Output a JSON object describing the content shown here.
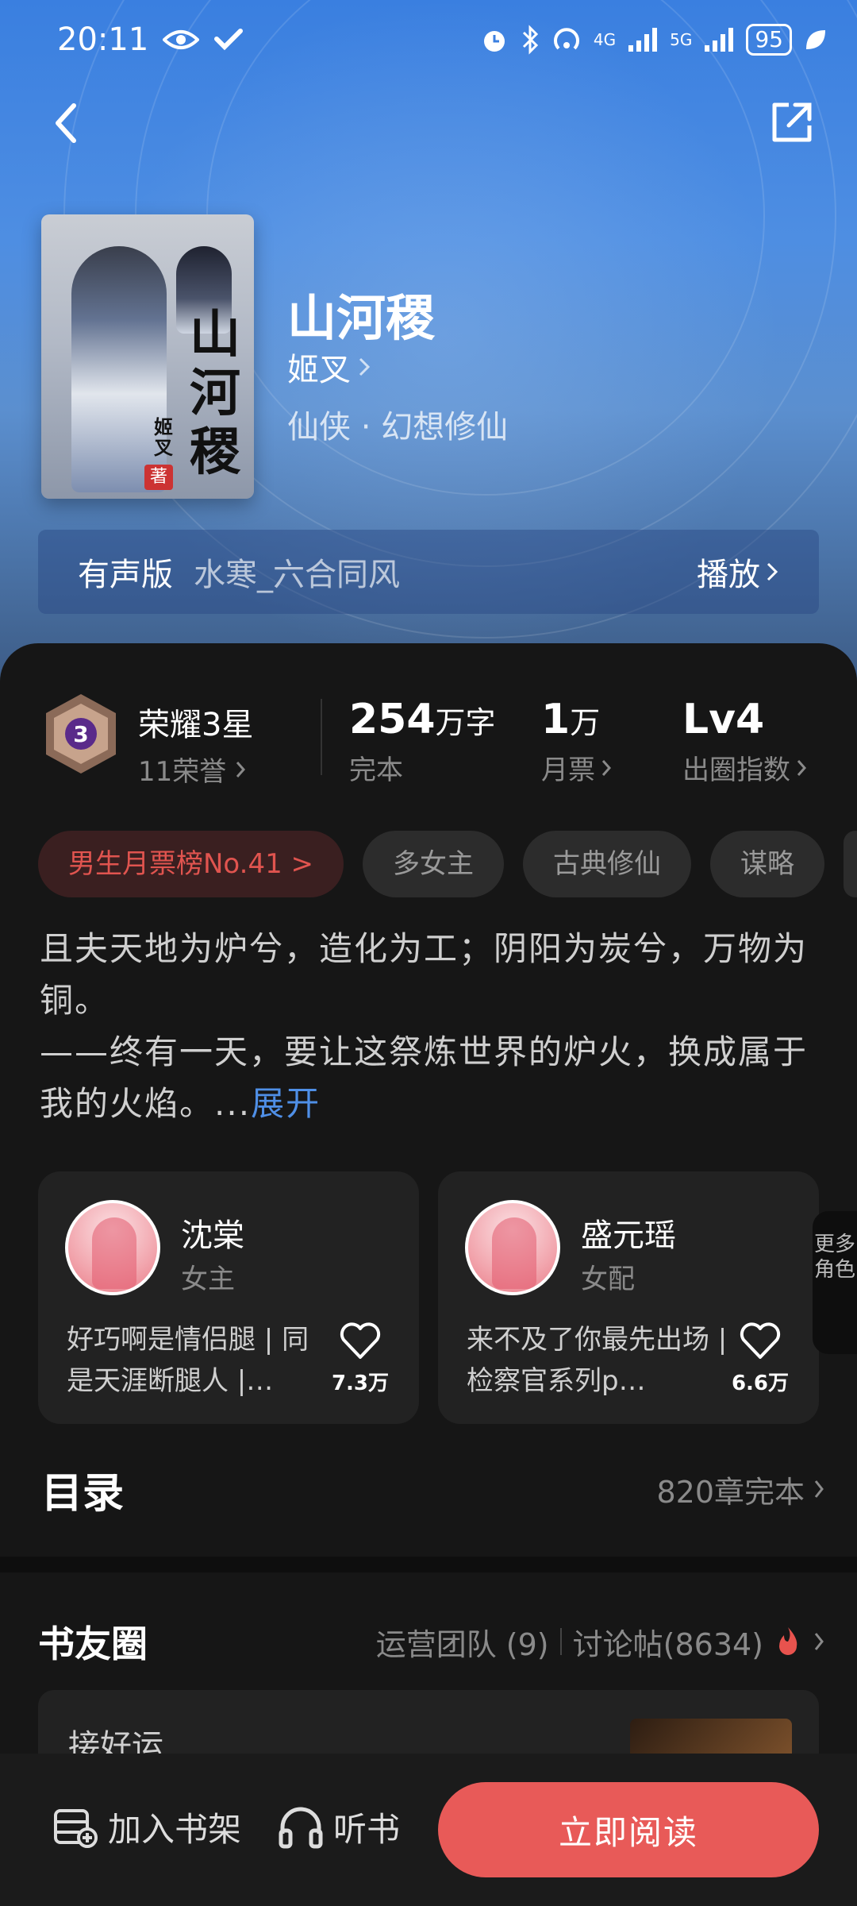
{
  "status_bar": {
    "time": "20:11",
    "signal1": "4G",
    "signal2": "5G",
    "battery": "95"
  },
  "book": {
    "title": "山河稷",
    "author": "姬叉",
    "genre": "仙侠 · 幻想修仙",
    "cover_title": "山河稷",
    "cover_author": "姬叉",
    "cover_seal": "著"
  },
  "audio": {
    "label": "有声版",
    "narrator": "水寒_六合同风",
    "play_label": "播放"
  },
  "stats": {
    "honor_title": "荣耀3星",
    "honor_sub": "11荣誉",
    "badge_level": "3",
    "words_num": "254",
    "words_unit": "万字",
    "words_sub": "完本",
    "votes_num": "1",
    "votes_unit": "万",
    "votes_sub": "月票",
    "index_num": "Lv4",
    "index_sub": "出圈指数"
  },
  "tags": [
    "男生月票榜No.41 >",
    "多女主",
    "古典修仙",
    "谋略"
  ],
  "synopsis": {
    "line1": "且夫天地为炉兮，造化为工；阴阳为炭兮，万物为铜。",
    "line2": "——终有一天，要让这祭炼世界的炉火，换成属于我的火焰。",
    "ellipsis": "...",
    "expand": "展开"
  },
  "characters": [
    {
      "name": "沈棠",
      "role": "女主",
      "desc": "好巧啊是情侣腿 | 同是天涯断腿人 |…",
      "likes": "7.3万"
    },
    {
      "name": "盛元瑶",
      "role": "女配",
      "desc": "来不及了你最先出场 | 检察官系列p…",
      "likes": "6.6万"
    }
  ],
  "more_roles": "更多角色",
  "catalog": {
    "title": "目录",
    "info": "820章完本"
  },
  "circle": {
    "title": "书友圈",
    "team": "运营团队 (9)",
    "posts": "讨论帖(8634)"
  },
  "post": {
    "title": "接好运"
  },
  "bottom": {
    "shelf": "加入书架",
    "listen": "听书",
    "read": "立即阅读"
  },
  "colors": {
    "accent_red": "#e85a58",
    "link_blue": "#4f8fe6",
    "hero_blue": "#3a7fe0"
  }
}
